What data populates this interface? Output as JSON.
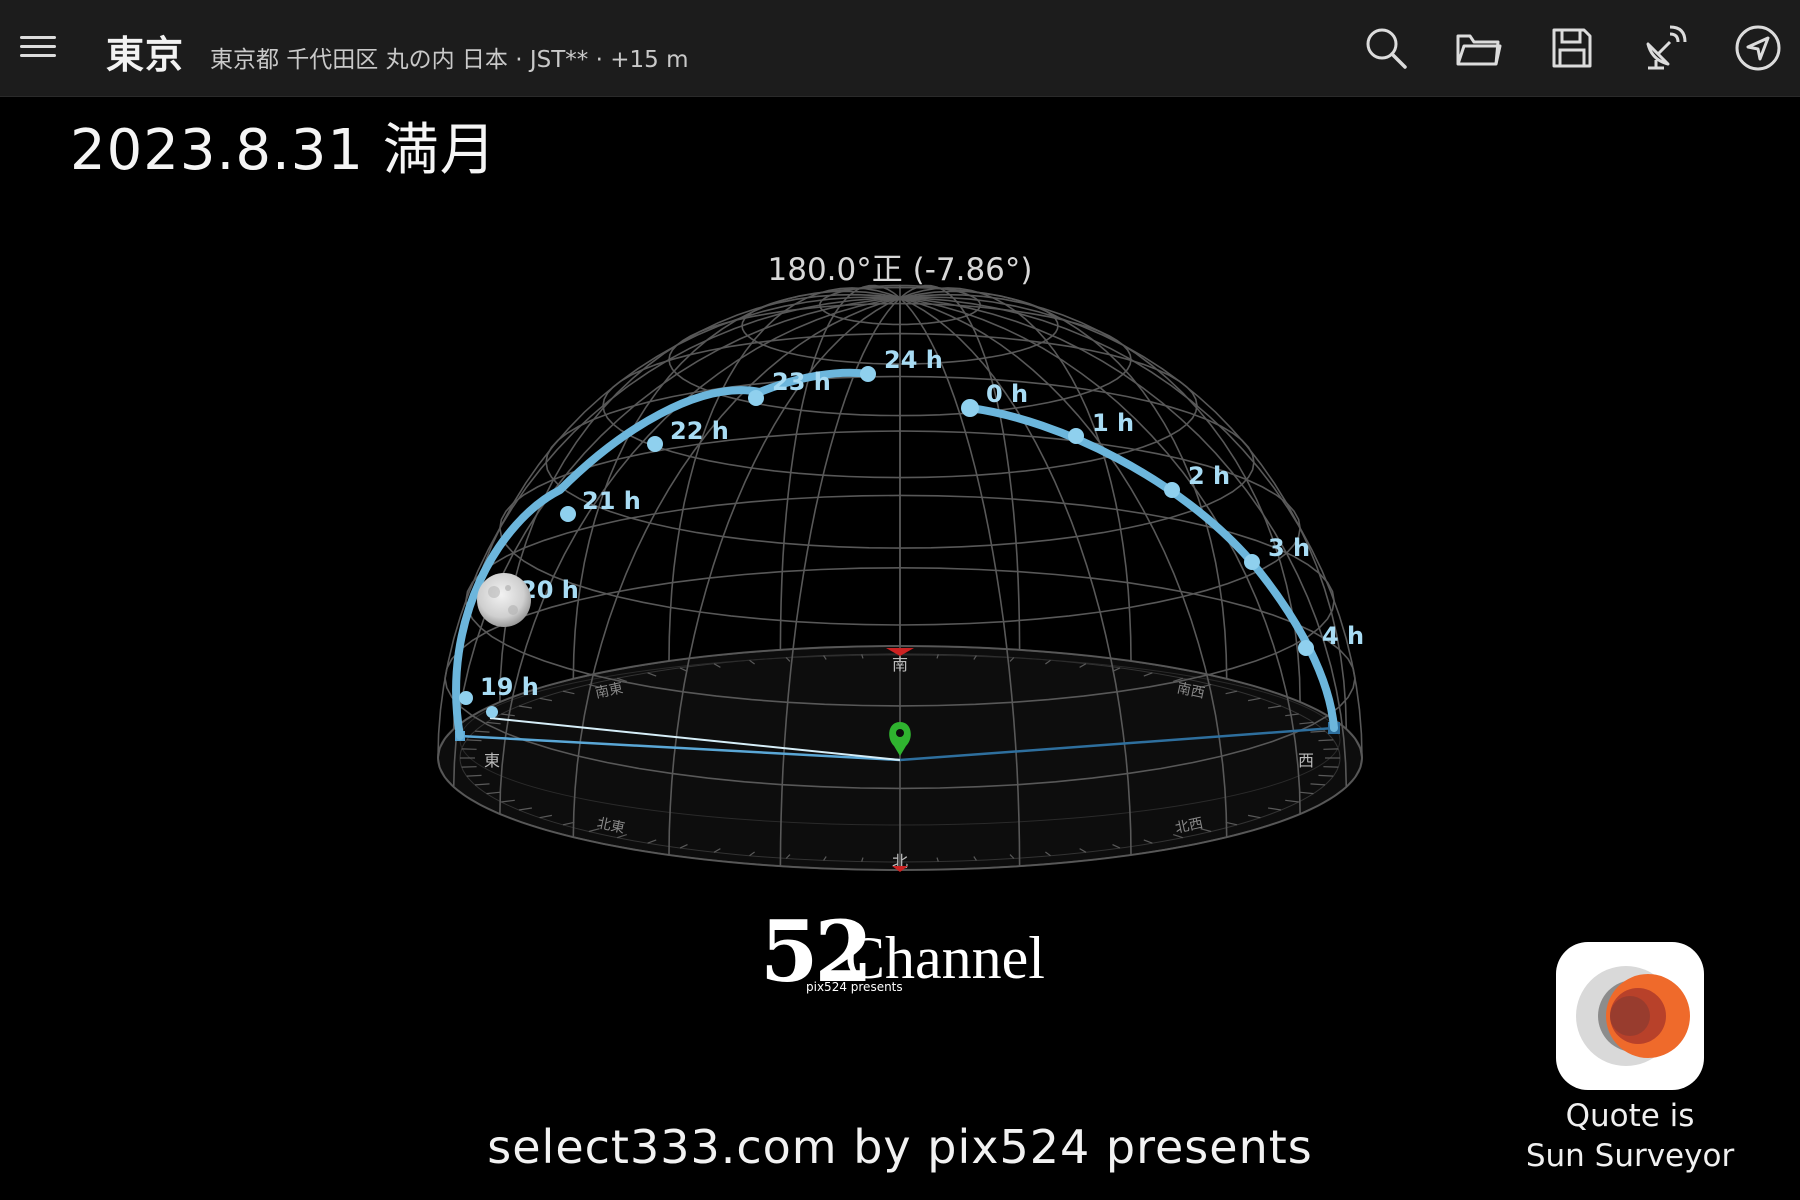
{
  "header": {
    "city": "東京",
    "location_detail": "東京都 千代田区 丸の内 日本 · JST** · +15 m",
    "icons": [
      "menu-icon",
      "search-icon",
      "folder-icon",
      "save-icon",
      "satellite-dish-icon",
      "navigation-arrow-icon"
    ]
  },
  "overlay": {
    "date_label": "2023.8.31 満月"
  },
  "view": {
    "heading_readout": "180.0°正 (-7.86°)"
  },
  "moon_path": {
    "hour_labels": [
      "19 h",
      "20 h",
      "21 h",
      "22 h",
      "23 h",
      "24 h",
      "0 h",
      "1 h",
      "2 h",
      "3 h",
      "4 h"
    ],
    "path_color": "#6cb6dc",
    "moon_at": "20 h"
  },
  "compass": {
    "south": "南",
    "north": "北",
    "east": "東",
    "west": "西",
    "southeast": "南東",
    "southwest": "南西",
    "northeast": "北東",
    "northwest": "北西"
  },
  "branding": {
    "logo_number": "52",
    "logo_word": "Channel",
    "logo_sub": "pix524 presents",
    "credit": "select333.com by pix524 presents",
    "app_caption_line1": "Quote is",
    "app_caption_line2": "Sun Surveyor"
  },
  "colors": {
    "topbar": "#1c1c1c",
    "path": "#6cb6dc",
    "grid": "#5a5a5a",
    "observer": "#2fb32f",
    "south_marker": "#cc2222"
  }
}
